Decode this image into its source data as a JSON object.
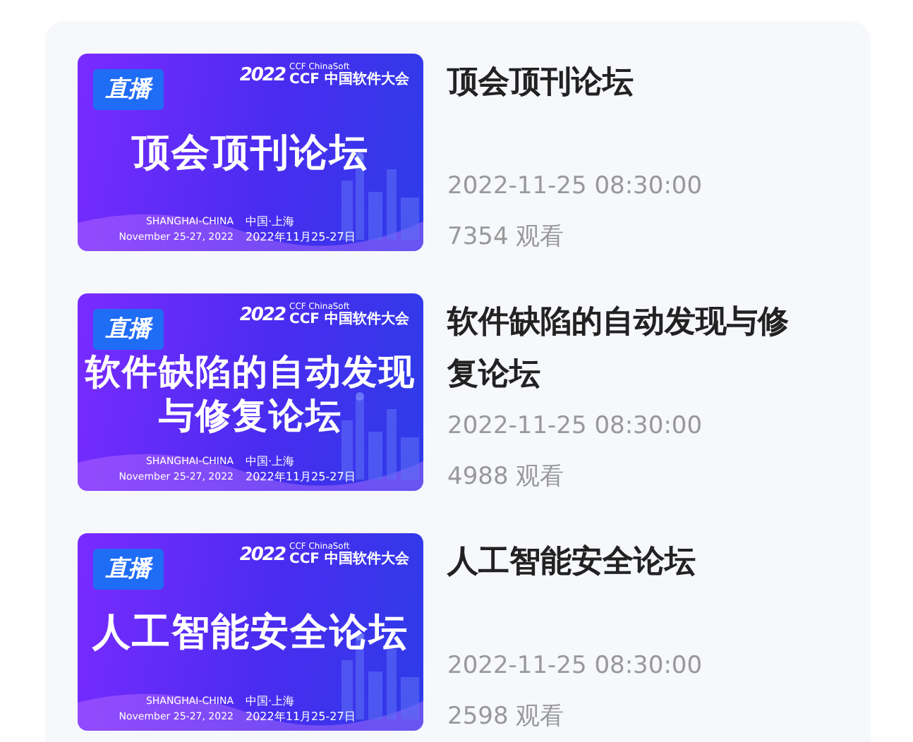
{
  "items": [
    {
      "banner": {
        "live_label": "直播",
        "series": "CCF ChinaSoft",
        "year": "2022",
        "conference": "CCF 中国软件大会",
        "title_lines": [
          "顶会顶刊论坛"
        ],
        "city_en": "SHANGHAI-CHINA",
        "city_zh": "中国·上海",
        "dates_en": "November 25-27, 2022",
        "dates_zh": "2022年11月25-27日"
      },
      "title": "顶会顶刊论坛",
      "time": "2022-11-25 08:30:00",
      "views": "7354 观看"
    },
    {
      "banner": {
        "live_label": "直播",
        "series": "CCF ChinaSoft",
        "year": "2022",
        "conference": "CCF 中国软件大会",
        "title_lines": [
          "软件缺陷的自动发现",
          "与修复论坛"
        ],
        "city_en": "SHANGHAI-CHINA",
        "city_zh": "中国·上海",
        "dates_en": "November 25-27, 2022",
        "dates_zh": "2022年11月25-27日"
      },
      "title": "软件缺陷的自动发现与修复论坛",
      "time": "2022-11-25 08:30:00",
      "views": "4988 观看"
    },
    {
      "banner": {
        "live_label": "直播",
        "series": "CCF ChinaSoft",
        "year": "2022",
        "conference": "CCF 中国软件大会",
        "title_lines": [
          "人工智能安全论坛"
        ],
        "city_en": "SHANGHAI-CHINA",
        "city_zh": "中国·上海",
        "dates_en": "November 25-27, 2022",
        "dates_zh": "2022年11月25-27日"
      },
      "title": "人工智能安全论坛",
      "time": "2022-11-25 08:30:00",
      "views": "2598 观看"
    }
  ]
}
